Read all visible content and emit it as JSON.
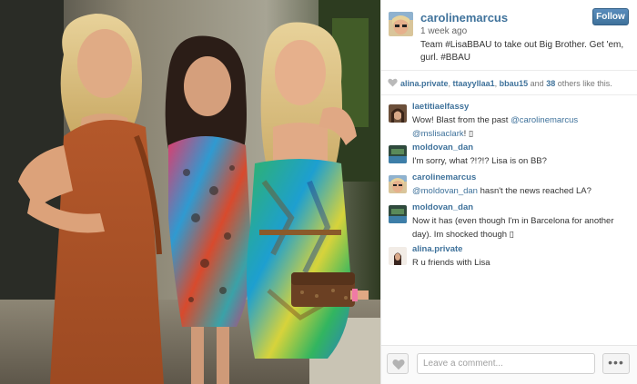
{
  "post": {
    "username": "carolinemarcus",
    "time_ago": "1 week ago",
    "caption": "Team #LisaBBAU to take out Big Brother. Get 'em, gurl. #BBAU",
    "follow_label": "Follow"
  },
  "likes": {
    "likers": [
      "alina.private",
      "ttaayyllaa1",
      "bbau15"
    ],
    "and_text": "and",
    "others_count": "38",
    "suffix": "others like this."
  },
  "comments": [
    {
      "user": "laetitiaelfassy",
      "parts": [
        "Wow! Blast from the past ",
        "@carolinemarcus",
        " ",
        "@mslisaclark",
        "! ▯"
      ]
    },
    {
      "user": "moldovan_dan",
      "parts": [
        "I'm sorry, what ?!?!? Lisa is on BB?"
      ]
    },
    {
      "user": "carolinemarcus",
      "parts": [
        "",
        "@moldovan_dan",
        " hasn't the news reached LA?"
      ]
    },
    {
      "user": "moldovan_dan",
      "parts": [
        "Now it has (even though I'm in Barcelona for another day). Im shocked though ▯"
      ]
    },
    {
      "user": "alina.private",
      "parts": [
        "R u friends with Lisa"
      ]
    }
  ],
  "footer": {
    "comment_placeholder": "Leave a comment...",
    "more_label": "•••"
  },
  "icons": {
    "like": "heart-icon",
    "more": "ellipsis-icon"
  },
  "colors": {
    "link": "#3f729b",
    "follow_button": "#3f729b"
  }
}
